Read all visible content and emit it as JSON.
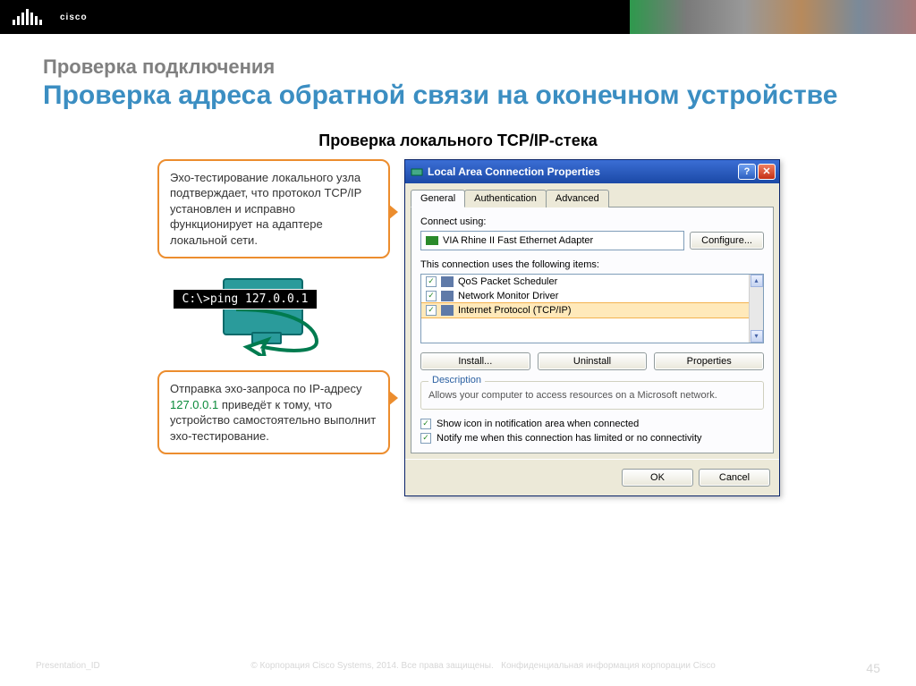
{
  "brand": "cisco",
  "slide": {
    "subtitle": "Проверка подключения",
    "title": "Проверка адреса обратной связи на оконечном устройстве",
    "diagram_title": "Проверка локального TCP/IP-стека"
  },
  "callouts": {
    "c1": "Эхо-тестирование локального узла подтверждает, что протокол TCP/IP установлен и исправно функционирует на адаптере локальной сети.",
    "c2_pre": "Отправка эхо-запроса по IP-адресу ",
    "c2_ip": "127.0.0.1",
    "c2_post": "  приведёт к тому, что устройство самостоятельно выполнит эхо-тестирование."
  },
  "ping": {
    "cmd": "C:\\>ping 127.0.0.1"
  },
  "dialog": {
    "title": "Local Area Connection Properties",
    "tabs": {
      "general": "General",
      "auth": "Authentication",
      "adv": "Advanced"
    },
    "connect_using": "Connect using:",
    "adapter": "VIA Rhine II Fast Ethernet Adapter",
    "configure": "Configure...",
    "items_label": "This connection uses the following items:",
    "items": {
      "qos": "QoS Packet Scheduler",
      "nmd": "Network Monitor Driver",
      "tcpip": "Internet Protocol (TCP/IP)"
    },
    "install": "Install...",
    "uninstall": "Uninstall",
    "properties": "Properties",
    "desc_title": "Description",
    "desc": "Allows your computer to access resources on a Microsoft network.",
    "show_icon": "Show icon in notification area when connected",
    "notify": "Notify me when this connection has limited or no connectivity",
    "ok": "OK",
    "cancel": "Cancel"
  },
  "footer": {
    "left": "Presentation_ID",
    "mid": "© Корпорация Cisco Systems, 2014. Все права защищены.",
    "right": "Конфиденциальная информация корпорации Cisco",
    "page": "45"
  }
}
